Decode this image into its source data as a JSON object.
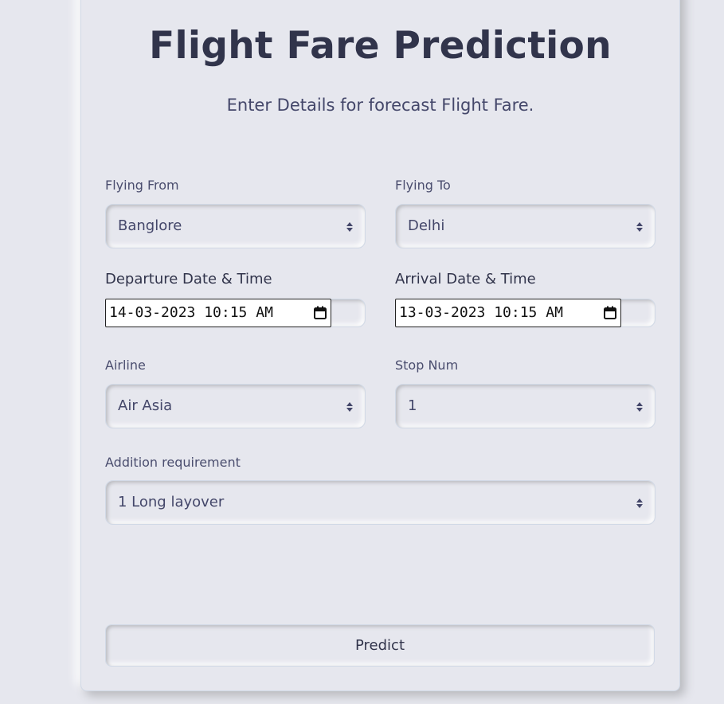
{
  "header": {
    "title": "Flight Fare Prediction",
    "subtitle": "Enter Details for forecast Flight Fare."
  },
  "form": {
    "flying_from": {
      "label": "Flying From",
      "value": "Banglore"
    },
    "flying_to": {
      "label": "Flying To",
      "value": "Delhi"
    },
    "departure": {
      "label": "Departure Date & Time",
      "value": "14-03-2023 10:15 AM"
    },
    "arrival": {
      "label": "Arrival Date & Time",
      "value": "13-03-2023 10:15 AM"
    },
    "airline": {
      "label": "Airline",
      "value": "Air Asia"
    },
    "stops": {
      "label": "Stop Num",
      "value": "1"
    },
    "addition": {
      "label": "Addition requirement",
      "value": "1 Long layover"
    },
    "submit_label": "Predict"
  },
  "icons": {
    "select_caret": "sort-arrows-icon",
    "date_picker": "calendar-icon"
  },
  "colors": {
    "background": "#e6e7ee",
    "text": "#44476a",
    "heading": "#31344b"
  }
}
